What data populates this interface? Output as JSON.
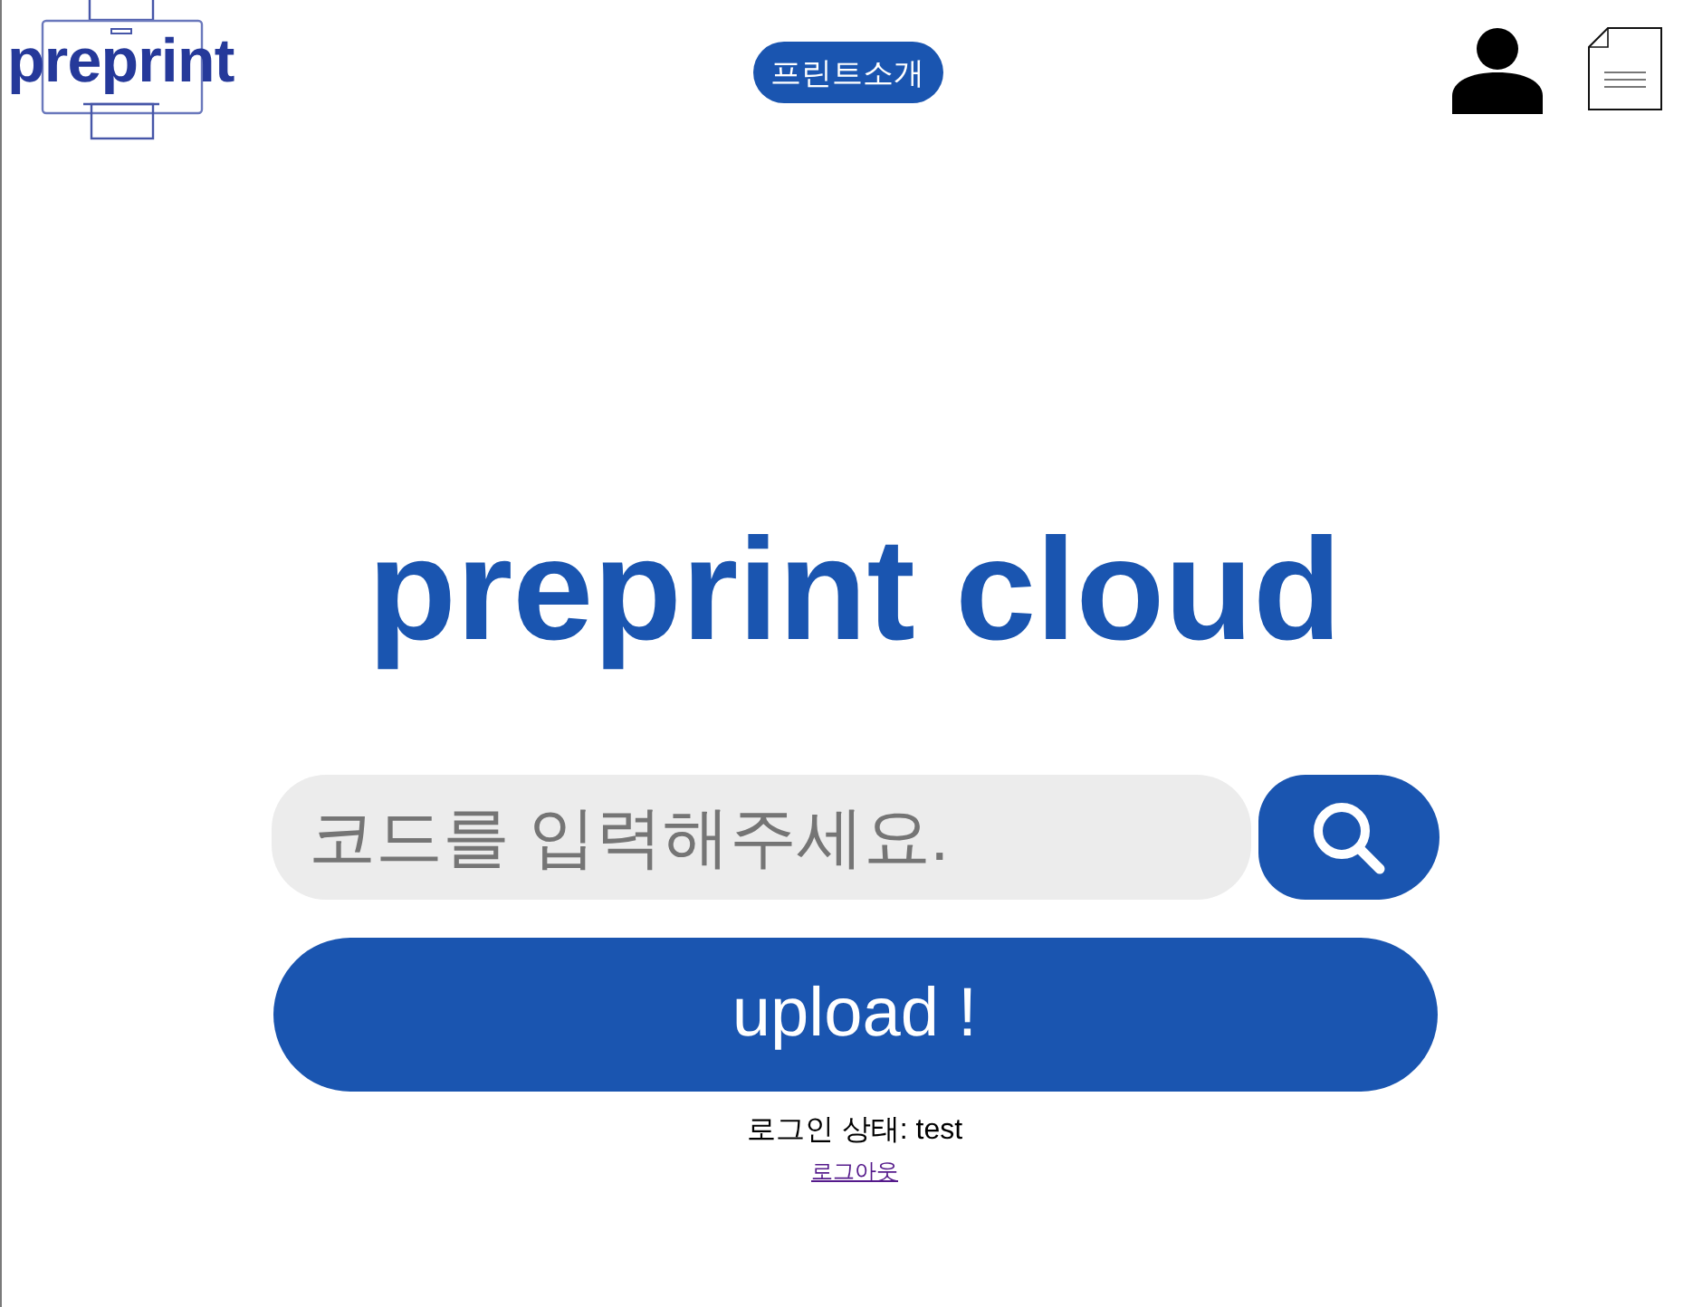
{
  "logo": {
    "text": "preprint"
  },
  "nav": {
    "items": [
      {
        "label": "프린트소개"
      }
    ]
  },
  "hero": {
    "title": "preprint cloud"
  },
  "search": {
    "placeholder": "코드를 입력해주세요."
  },
  "upload_button": {
    "label": "upload !"
  },
  "login_status": {
    "text": "로그인 상태: test"
  },
  "logout_link": {
    "label": "로그아웃",
    "visited": true
  }
}
